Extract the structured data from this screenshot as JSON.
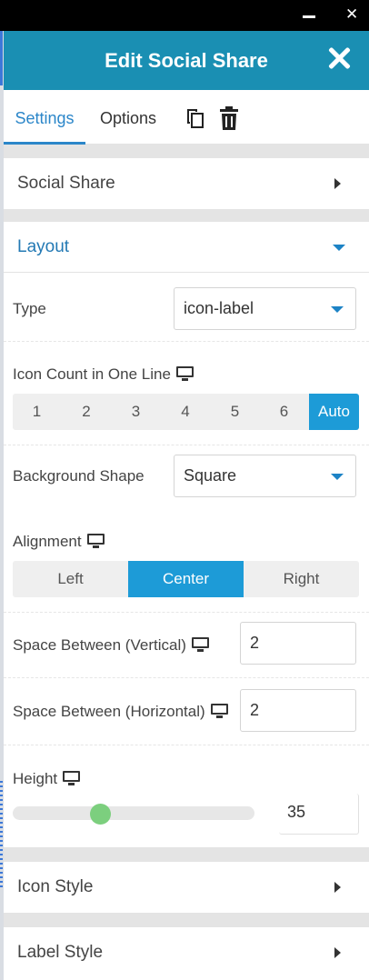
{
  "window": {
    "minimize_glyph": "",
    "close_glyph": "✕"
  },
  "header": {
    "title": "Edit Social Share",
    "close_icon": "close-icon"
  },
  "tabs": [
    {
      "label": "Settings",
      "active": true
    },
    {
      "label": "Options",
      "active": false
    }
  ],
  "toolbar": {
    "duplicate_icon": "copy-icon",
    "delete_icon": "trash-icon"
  },
  "sections": {
    "social_share": {
      "label": "Social Share",
      "expanded": false
    },
    "layout": {
      "label": "Layout",
      "expanded": true
    },
    "icon_style": {
      "label": "Icon Style",
      "expanded": false
    },
    "label_style": {
      "label": "Label Style",
      "expanded": false
    }
  },
  "layout": {
    "type": {
      "label": "Type",
      "value": "icon-label"
    },
    "icon_count": {
      "label": "Icon Count in One Line",
      "options": [
        "1",
        "2",
        "3",
        "4",
        "5",
        "6",
        "Auto"
      ],
      "selected": "Auto"
    },
    "background_shape": {
      "label": "Background Shape",
      "value": "Square"
    },
    "alignment": {
      "label": "Alignment",
      "options": [
        "Left",
        "Center",
        "Right"
      ],
      "selected": "Center"
    },
    "space_vertical": {
      "label": "Space Between (Vertical)",
      "value": "2"
    },
    "space_horizontal": {
      "label": "Space Between (Horizontal)",
      "value": "2"
    },
    "height": {
      "label": "Height",
      "value": "35"
    }
  },
  "colors": {
    "header_bg": "#1a8fb3",
    "accent_blue": "#1d9bd7",
    "tab_active": "#2b86c9",
    "slider_thumb": "#7ccf7e"
  }
}
